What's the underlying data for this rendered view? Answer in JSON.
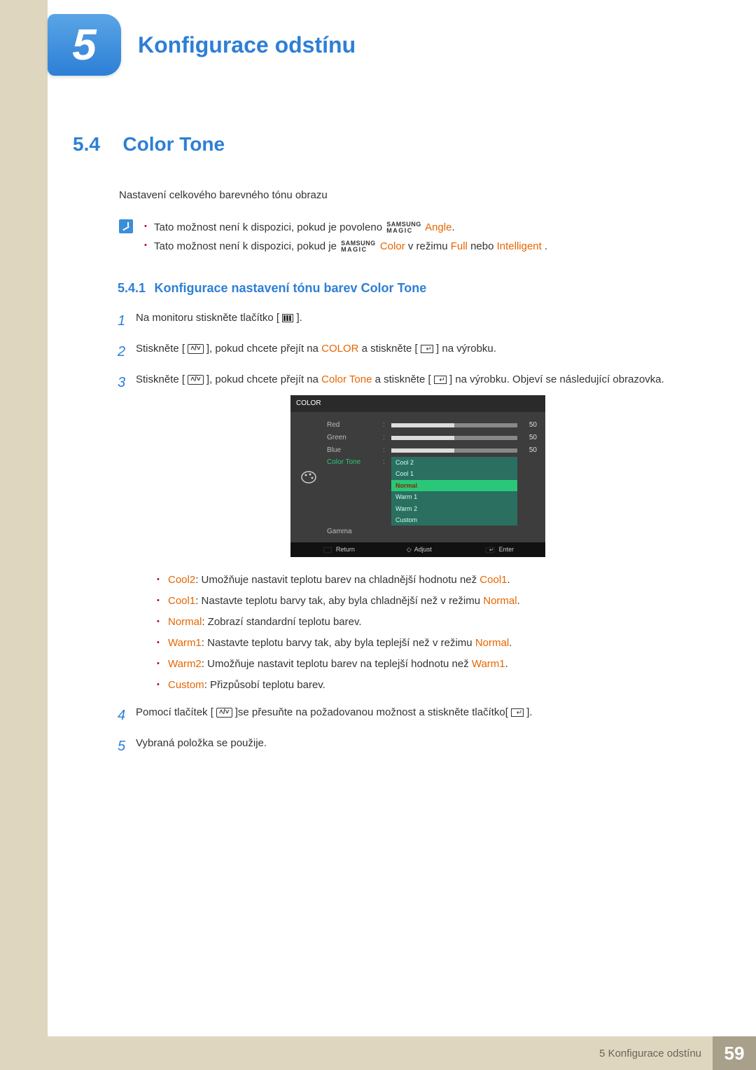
{
  "chapter": {
    "num": "5",
    "title": "Konfigurace odstínu"
  },
  "section": {
    "num": "5.4",
    "title": "Color Tone"
  },
  "intro": "Nastavení celkového barevného tónu obrazu",
  "notes": {
    "n1a": "Tato možnost není k dispozici, pokud je povoleno ",
    "magic1": {
      "top": "SAMSUNG",
      "bot": "MAGIC"
    },
    "n1b": "Angle",
    "n1c": ".",
    "n2a": "Tato možnost není k dispozici, pokud je ",
    "magic2": {
      "top": "SAMSUNG",
      "bot": "MAGIC"
    },
    "n2b": "Color",
    "n2c": " v režimu ",
    "n2d": "Full",
    "n2e": " nebo ",
    "n2f": "Intelligent",
    "n2g": "."
  },
  "subsection": {
    "num": "5.4.1",
    "title": "Konfigurace nastavení tónu barev Color Tone"
  },
  "steps": {
    "s1": "Na monitoru stiskněte tlačítko [",
    "s1b": "].",
    "s2a": "Stiskněte [",
    "s2b": "], pokud chcete přejít na ",
    "s2c": "COLOR",
    "s2d": " a stiskněte [",
    "s2e": "] na výrobku.",
    "s3a": "Stiskněte [",
    "s3b": "], pokud chcete přejít na ",
    "s3c": "Color Tone",
    "s3d": " a stiskněte [",
    "s3e": "] na výrobku. Objeví se následující obrazovka.",
    "s4a": "Pomocí tlačítek [",
    "s4b": "]se přesuňte na požadovanou možnost a stiskněte tlačítko[",
    "s4c": "].",
    "s5": "Vybraná položka se použije."
  },
  "osd": {
    "header": "COLOR",
    "rows": [
      {
        "label": "Red",
        "val": "50"
      },
      {
        "label": "Green",
        "val": "50"
      },
      {
        "label": "Blue",
        "val": "50"
      }
    ],
    "tone_label": "Color Tone",
    "gamma_label": "Gamma",
    "options": [
      "Cool 2",
      "Cool 1",
      "Normal",
      "Warm 1",
      "Warm 2",
      "Custom"
    ],
    "selected": "Normal",
    "footer": {
      "return": "Return",
      "adjust": "Adjust",
      "enter": "Enter"
    }
  },
  "bullets": {
    "b1a": "Cool2",
    "b1b": ": Umožňuje nastavit teplotu barev na chladnější hodnotu než ",
    "b1c": "Cool1",
    "b1d": ".",
    "b2a": "Cool1",
    "b2b": ": Nastavte teplotu barvy tak, aby byla chladnější než v režimu ",
    "b2c": "Normal",
    "b2d": ".",
    "b3a": "Normal",
    "b3b": ": Zobrazí standardní teplotu barev.",
    "b4a": "Warm1",
    "b4b": ": Nastavte teplotu barvy tak, aby byla teplejší než v režimu ",
    "b4c": "Normal",
    "b4d": ".",
    "b5a": "Warm2",
    "b5b": ": Umožňuje nastavit teplotu barev na teplejší hodnotu než ",
    "b5c": "Warm1",
    "b5d": ".",
    "b6a": "Custom",
    "b6b": ": Přizpůsobí teplotu barev."
  },
  "footer": {
    "text": "5 Konfigurace odstínu",
    "page": "59"
  },
  "chart_data": {
    "type": "table",
    "title": "COLOR OSD menu",
    "sliders": [
      {
        "name": "Red",
        "value": 50,
        "range": [
          0,
          100
        ]
      },
      {
        "name": "Green",
        "value": 50,
        "range": [
          0,
          100
        ]
      },
      {
        "name": "Blue",
        "value": 50,
        "range": [
          0,
          100
        ]
      }
    ],
    "color_tone_options": [
      "Cool 2",
      "Cool 1",
      "Normal",
      "Warm 1",
      "Warm 2",
      "Custom"
    ],
    "color_tone_selected": "Normal"
  }
}
